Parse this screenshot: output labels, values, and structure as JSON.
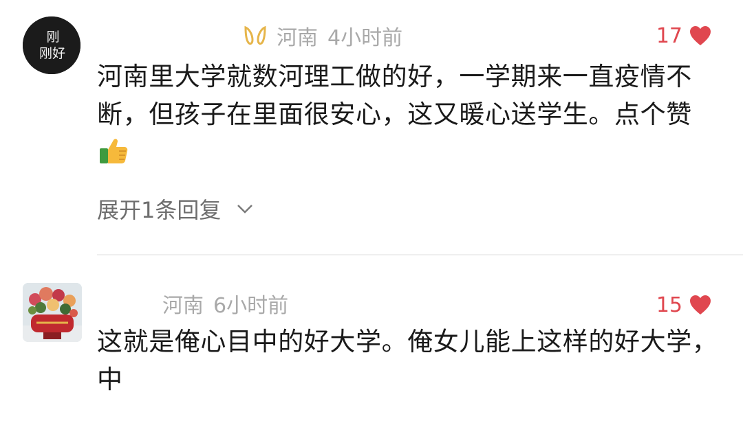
{
  "comments": [
    {
      "location": "河南",
      "time": "4小时前",
      "likes": "17",
      "avatar_text": [
        "刚",
        "刚好"
      ],
      "text": "河南里大学就数河理工做的好，一学期来一直疫情不断，但孩子在里面很安心，这又暖心送学生。点个赞",
      "expand_label": "展开1条回复"
    },
    {
      "location": "河南",
      "time": "6小时前",
      "likes": "15",
      "text": "这就是俺心目中的好大学。俺女儿能上这样的好大学，中"
    }
  ],
  "icons": {
    "badge": "gold-badge-icon",
    "heart": "heart-icon",
    "thumb": "thumbs-up-emoji",
    "chevron": "chevron-down-icon"
  },
  "colors": {
    "like": "#e0474f",
    "meta": "#a9a9a9",
    "badge": "#e6b54a",
    "text": "#1a1a1a"
  }
}
